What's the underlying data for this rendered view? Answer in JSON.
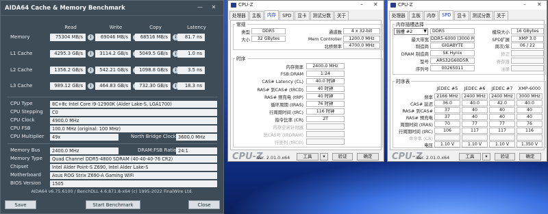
{
  "aida": {
    "title": "AIDA64 Cache & Memory Benchmark",
    "window_controls": [
      "—",
      "✕"
    ],
    "columns": [
      "Read",
      "Write",
      "Copy",
      "Latency"
    ],
    "rows": [
      {
        "label": "Memory",
        "read": "75304 MB/s",
        "write": "69046 MB/s",
        "copy": "68516 MB/s",
        "latency": "81.7 ns"
      },
      {
        "label": "L1 Cache",
        "read": "4295.3 GB/s",
        "write": "3114.2 GB/s",
        "copy": "5049.5 GB/s",
        "latency": "1.0 ns"
      },
      {
        "label": "L2 Cache",
        "read": "1356.2 GB/s",
        "write": "542.21 GB/s",
        "copy": "1098.8 GB/s",
        "latency": "3.5 ns"
      },
      {
        "label": "L3 Cache",
        "read": "989.12 GB/s",
        "write": "464.83 GB/s",
        "copy": "732.30 GB/s",
        "latency": "18.3 ns"
      }
    ],
    "info": {
      "cpu_type_label": "CPU Type",
      "cpu_type": "8C+8c Intel Core i9-12900K (Alder Lake-S, LGA1700)",
      "cpu_stepping_label": "CPU Stepping",
      "cpu_stepping": "C0",
      "cpu_clock_label": "CPU Clock",
      "cpu_clock": "4900.0 MHz",
      "cpu_fsb_label": "CPU FSB",
      "cpu_fsb": "100.0 MHz  (original: 100 MHz)",
      "cpu_multiplier_label": "CPU Multiplier",
      "cpu_multiplier": "49x",
      "nb_clock_label": "North Bridge Clock",
      "nb_clock": "3600.0 MHz",
      "memory_bus_label": "Memory Bus",
      "memory_bus": "2400.0 MHz",
      "dram_fsb_label": "DRAM:FSB Ratio",
      "dram_fsb": "24:1",
      "memory_type_label": "Memory Type",
      "memory_type": "Quad Channel DDR5-4800 SDRAM  (40-40-40-76 CR2)",
      "chipset_label": "Chipset",
      "chipset": "Intel Alder Point-S Z690, Intel Alder Lake-S",
      "motherboard_label": "Motherboard",
      "motherboard": "Asus ROG Strix Z690-A Gaming WiFi",
      "bios_label": "BIOS Version",
      "bios": "1505"
    },
    "footer": "AIDA64 v6.75.6100 / BenchDLL 4.6.871.8-x64  (c) 1995-2022 FinalWire Ltd.",
    "buttons": {
      "save": "Save",
      "start": "Start Benchmark",
      "close": "Close"
    }
  },
  "cpuz1": {
    "title": "CPU-Z",
    "tabs": [
      "处理器",
      "主板",
      "内存",
      "SPD",
      "显卡",
      "测试分数",
      "关于"
    ],
    "active_tab": "内存",
    "general": {
      "title": "常规",
      "type_label": "类型",
      "type": "DDR5",
      "size_label": "大小",
      "size": "32 GBytes",
      "channels_label": "通道数",
      "channels": "4 x 32-bit",
      "mc_label": "Mem Controller",
      "mc": "1200.0 MHz",
      "nb_label": "北桥频率",
      "nb": "4700.0 MHz"
    },
    "timings": {
      "title": "时序",
      "rows": [
        {
          "label": "内存频率",
          "value": "2400.0 MHz"
        },
        {
          "label": "FSB:DRAM",
          "value": "1:24"
        },
        {
          "label": "CAS# Latency (CL)",
          "value": "40.0 时钟"
        },
        {
          "label": "RAS# 到CAS# (tRCD)",
          "value": "40 时钟"
        },
        {
          "label": "RAS# 预充电 (tRP)",
          "value": "40 时钟"
        },
        {
          "label": "循环周期 (tRAS)",
          "value": "76 时钟"
        },
        {
          "label": "行周期时间 (tRC)",
          "value": "116 时钟"
        },
        {
          "label": "指令比率 (CR)",
          "value": "2T"
        },
        {
          "label": "内存空闲计时器",
          "value": ""
        },
        {
          "label": "总CAS号 (tRDRAM)",
          "value": ""
        },
        {
          "label": "行至列 (tRCD)",
          "value": ""
        }
      ]
    },
    "footer": {
      "logo": "CPU-Z",
      "version": "Ver. 2.01.0.x64",
      "tools": "工具",
      "validate": "验证",
      "ok": "确定"
    }
  },
  "cpuz2": {
    "title": "CPU-Z",
    "tabs": [
      "处理器",
      "主板",
      "内存",
      "SPD",
      "显卡",
      "测试分数",
      "关于"
    ],
    "active_tab": "SPD",
    "slot": {
      "title": "内存插槽选择",
      "slot_value": "插槽 #2",
      "type": "DDR5",
      "max_bw_label": "最大带宽",
      "max_bw": "DDR5-6000 (3000 MHz)",
      "mfr_label": "制造商",
      "mfr": "GIGABYTE",
      "dram_mfr_label": "DRAM 制造商",
      "dram_mfr": "SK Hynix",
      "part_label": "型号",
      "part": "ARS32G60D5R",
      "serial_label": "序列号",
      "serial": "00265011",
      "module_size_label": "模块大小",
      "module_size": "16 GBytes",
      "spd_ext_label": "SPD扩展",
      "spd_ext": "XMP 3.0",
      "week_year_label": "周次/年",
      "week_year": "06 / 22",
      "correction_label": "修正",
      "registered_label": "寄存器",
      "buffered_label": "注册"
    },
    "timings": {
      "title": "时序表",
      "headers": [
        "JEDEC #5",
        "JEDEC #6",
        "JEDEC #7",
        "XMP-6000"
      ],
      "rows": [
        {
          "label": "频率",
          "values": [
            "2166 MHz",
            "2400 MHz",
            "2400 MHz",
            "3000 MHz"
          ],
          "dim": false
        },
        {
          "label": "CAS# 延迟",
          "values": [
            "36.0",
            "40.0",
            "42.0",
            "40.0"
          ],
          "dim": false
        },
        {
          "label": "RAS# 到CAS#",
          "values": [
            "37",
            "40",
            "40",
            "40"
          ],
          "dim": false
        },
        {
          "label": "RAS# 预充电",
          "values": [
            "37",
            "40",
            "40",
            "40"
          ],
          "dim": false
        },
        {
          "label": "周期时间 (tRAS)",
          "values": [
            "70",
            "77",
            "77",
            "76"
          ],
          "dim": false
        },
        {
          "label": "行周期时间 (tRC)",
          "values": [
            "106",
            "117",
            "117",
            "116"
          ],
          "dim": false
        },
        {
          "label": "命令率 (CR)",
          "values": [
            "",
            "",
            "",
            ""
          ],
          "dim": true
        },
        {
          "label": "电压",
          "values": [
            "1.10 V",
            "1.10 V",
            "1.10 V",
            "1.350 V"
          ],
          "dim": false
        }
      ]
    },
    "footer": {
      "logo": "CPU-Z",
      "version": "Ver. 2.01.0.x64",
      "tools": "工具",
      "validate": "验证",
      "ok": "确定"
    }
  }
}
